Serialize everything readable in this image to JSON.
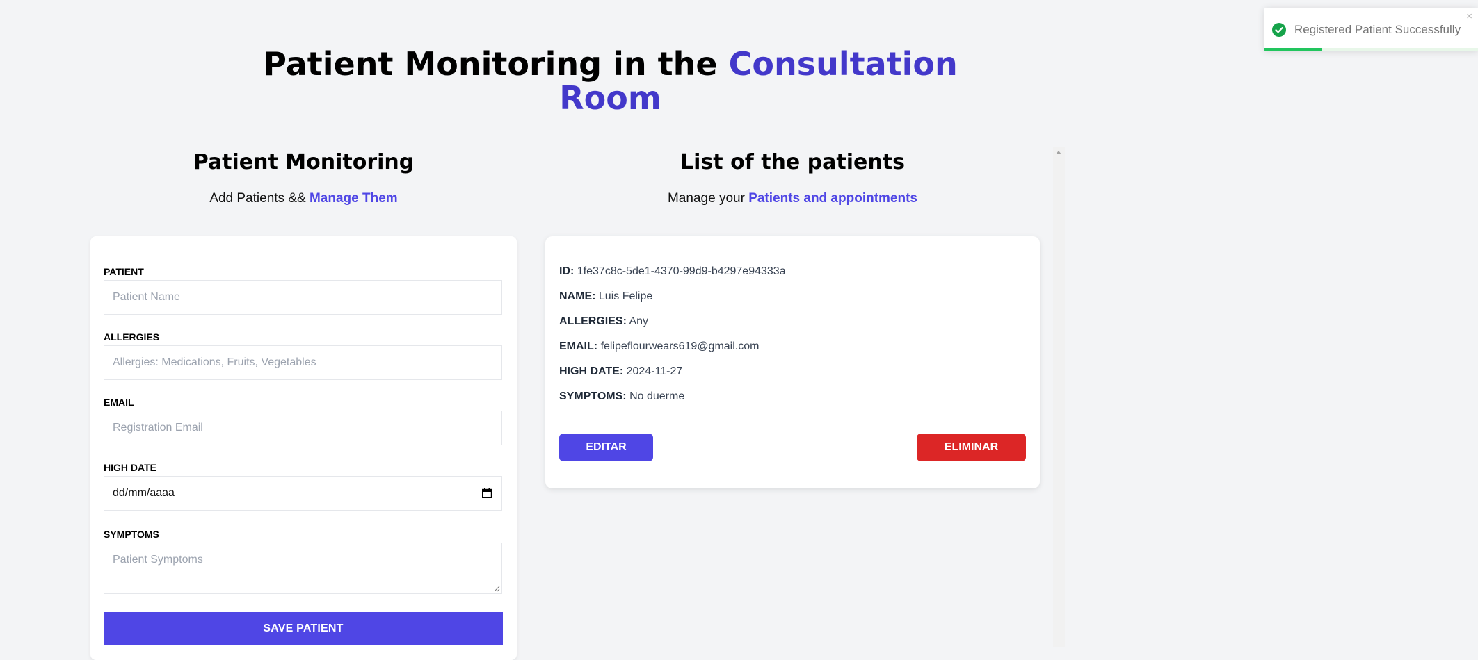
{
  "header": {
    "title_part1": "Patient Monitoring in the ",
    "title_accent_line1": "Consultation",
    "title_accent_line2": "Room"
  },
  "left_section": {
    "title": "Patient Monitoring",
    "subtitle_plain": "Add Patients && ",
    "subtitle_accent": "Manage Them"
  },
  "right_section": {
    "title": "List of the patients",
    "subtitle_plain": "Manage your ",
    "subtitle_accent": "Patients and appointments"
  },
  "form": {
    "patient_label": "PATIENT",
    "patient_placeholder": "Patient Name",
    "allergies_label": "ALLERGIES",
    "allergies_placeholder": "Allergies: Medications, Fruits, Vegetables",
    "email_label": "EMAIL",
    "email_placeholder": "Registration Email",
    "high_date_label": "HIGH DATE",
    "high_date_value": "dd/mm/aaaa",
    "symptoms_label": "SYMPTOMS",
    "symptoms_placeholder": "Patient Symptoms",
    "save_label": "SAVE PATIENT"
  },
  "patients": [
    {
      "id_label": "ID:",
      "id": "1fe37c8c-5de1-4370-99d9-b4297e94333a",
      "name_label": "NAME:",
      "name": "Luis Felipe",
      "allergies_label": "ALLERGIES:",
      "allergies": "Any",
      "email_label": "EMAIL:",
      "email": "felipeflourwears619@gmail.com",
      "high_date_label": "HIGH DATE:",
      "high_date": "2024-11-27",
      "symptoms_label": "SYMPTOMS:",
      "symptoms": "No duerme",
      "edit_label": "EDITAR",
      "delete_label": "ELIMINAR"
    }
  ],
  "toast": {
    "message": "Registered Patient Successfully",
    "close_glyph": "×",
    "icon": "check-circle-icon",
    "progress_fraction": 0.27
  },
  "colors": {
    "accent": "#4338ca",
    "primary_button": "#4f46e5",
    "danger_button": "#dc2626",
    "success": "#22c55e",
    "background": "#f3f4f6"
  }
}
